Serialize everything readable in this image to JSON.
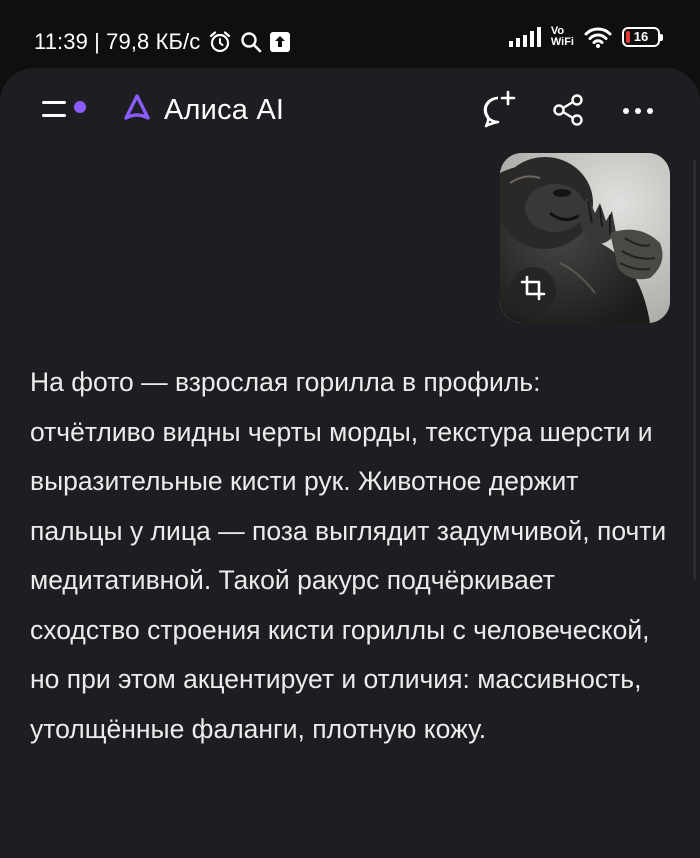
{
  "status_bar": {
    "time_speed": "11:39 | 79,8 КБ/с",
    "vowifi_top": "Vo",
    "vowifi_bottom": "WiFi",
    "battery_level": "16",
    "battery_color": "#e53935"
  },
  "icons": {
    "alarm": "alarm-icon",
    "search": "search-icon",
    "upload": "upload-icon",
    "signal": "signal-bars-icon",
    "wifi": "wifi-icon",
    "menu": "menu-icon",
    "new_chat": "new-chat-icon",
    "share": "share-icon",
    "more": "more-icon",
    "crop": "crop-icon",
    "brand": "alice-logo-icon"
  },
  "header": {
    "title": "Алиса AI",
    "accent_color": "#8a5cff"
  },
  "message": {
    "image_alt": "Горилла",
    "text": "На фото — взрослая горилла в профиль: отчётливо видны черты морды, текстура шерсти и выразительные кисти рук. Животное держит пальцы у лица — поза выглядит задумчивой, почти медитативной. Такой ракурс подчёркивает сходство строения кисти гориллы с человеческой, но при этом акцентирует и отличия: массивность, утолщённые фаланги, плотную кожу."
  }
}
